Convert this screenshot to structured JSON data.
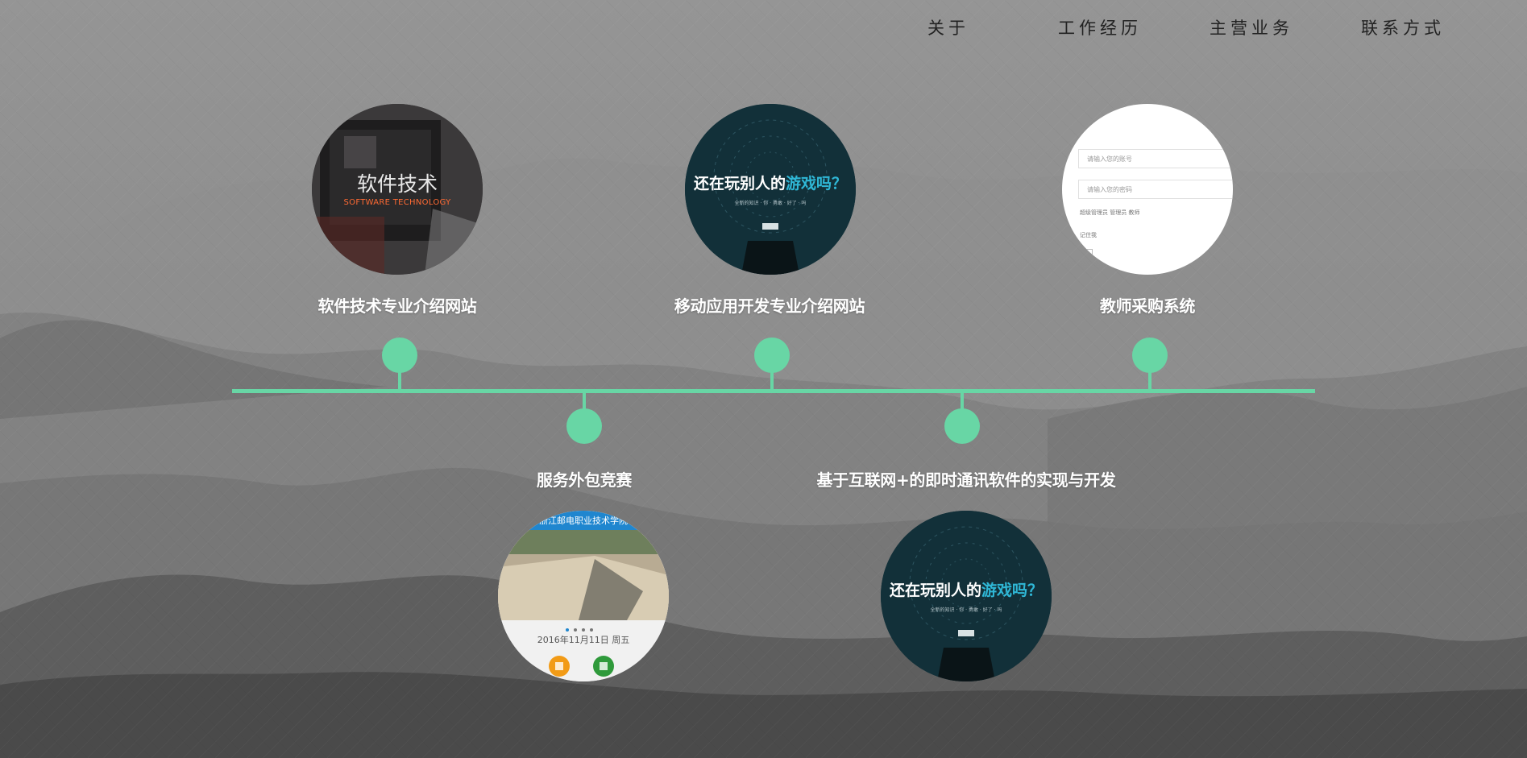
{
  "nav": {
    "items": [
      {
        "label": "关于"
      },
      {
        "label": "工作经历"
      },
      {
        "label": "主营业务"
      },
      {
        "label": "联系方式"
      }
    ]
  },
  "timeline": {
    "accent_color": "#68d6a5",
    "items": [
      {
        "label": "软件技术专业介绍网站",
        "thumb_title": "软件技术",
        "thumb_subtitle": "SOFTWARE TECHNOLOGY"
      },
      {
        "label": "服务外包竞赛",
        "thumb_banner": "浙江邮电职业技术学院",
        "thumb_date": "2016年11月11日 周五"
      },
      {
        "label": "移动应用开发专业介绍网站",
        "thumb_title_a": "还在玩别人的",
        "thumb_title_b": "游戏吗？",
        "thumb_subtitle": "全新的知识 · 你 · 勇敢 · 好了 · 吗"
      },
      {
        "label": "基于互联网+的即时通讯软件的实现与开发",
        "thumb_title_a": "还在玩别人的",
        "thumb_title_b": "游戏吗？",
        "thumb_subtitle": "全新的知识 · 你 · 勇敢 · 好了 · 吗"
      },
      {
        "label": "教师采购系统",
        "thumb_field_1": "请输入您的账号",
        "thumb_field_2": "请输入您的密码",
        "thumb_roles": "超级管理员  管理员  教师",
        "thumb_remember": "记住我"
      }
    ]
  }
}
